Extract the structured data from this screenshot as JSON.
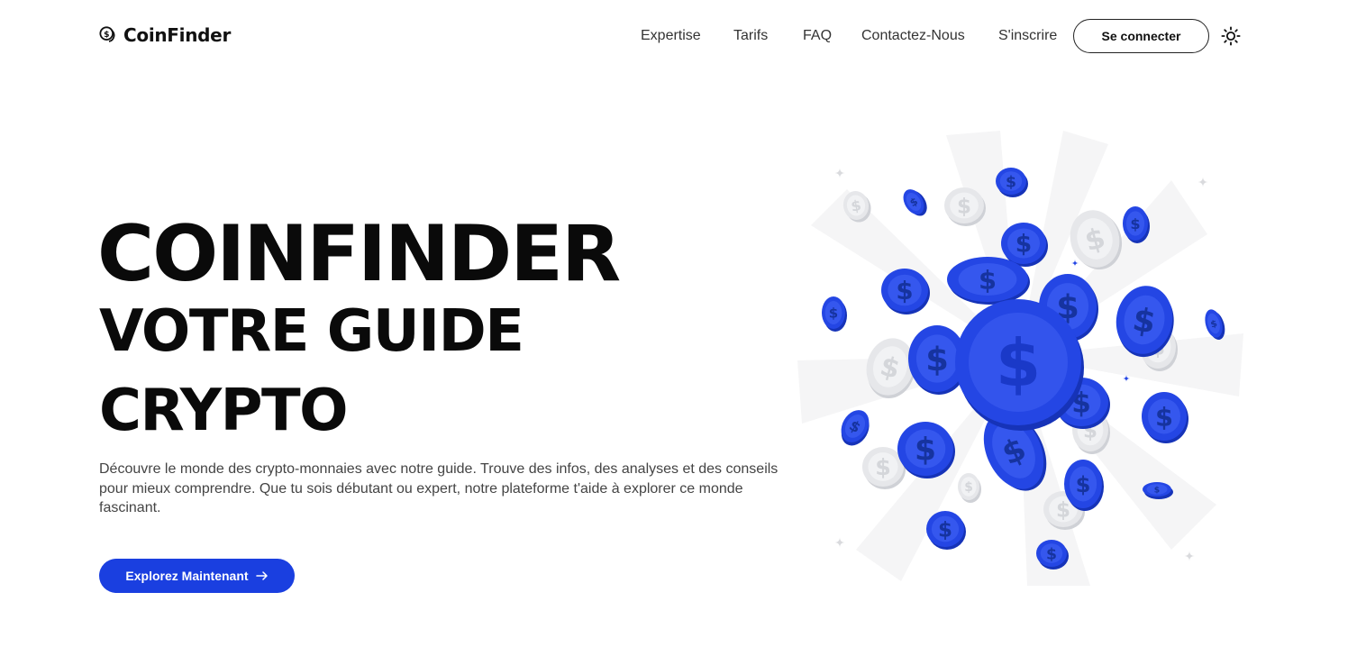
{
  "brand": {
    "name": "CoinFinder",
    "logo_icon": "dollar-coin-icon"
  },
  "nav": {
    "links": [
      "Expertise",
      "Tarifs",
      "FAQ",
      "Contactez-Nous",
      "S'inscrire"
    ],
    "login_label": "Se connecter",
    "theme_icon": "sun-icon"
  },
  "hero": {
    "title": "COINFINDER",
    "subtitle_line1": "VOTRE GUIDE",
    "subtitle_line2": "CRYPTO",
    "description": "Découvre le monde des crypto-monnaies avec notre guide. Trouve des infos, des analyses et des conseils pour mieux comprendre. Que tu sois débutant ou expert, notre plateforme t'aide à explorer ce monde fascinant.",
    "cta_label": "Explorez Maintenant",
    "cta_icon": "arrow-right-icon",
    "illustration": "floating-dollar-coins-illustration"
  },
  "colors": {
    "accent": "#1a3fe0",
    "coin_blue": "#2446e4",
    "coin_gray": "#e6e7ea",
    "text": "#0a0a0a"
  }
}
